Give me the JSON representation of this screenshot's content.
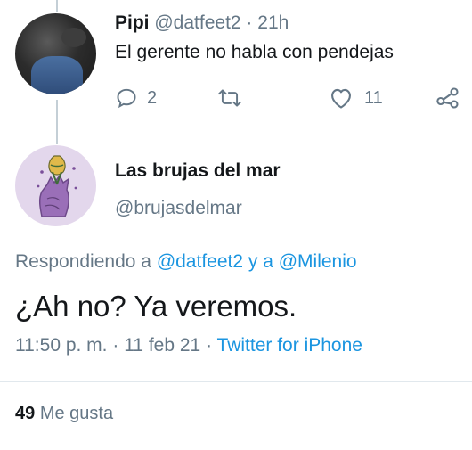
{
  "parent_tweet": {
    "name": "Pipi",
    "handle": "@datfeet2",
    "separator": "·",
    "time": "21h",
    "text": "El gerente no habla con pendejas",
    "reply_count": "2",
    "like_count": "11"
  },
  "main_tweet": {
    "name": "Las brujas del mar",
    "handle": "@brujasdelmar",
    "replying_prefix": "Respondiendo a",
    "reply_to_1": "@datfeet2",
    "reply_conjunction": "y a",
    "reply_to_2": "@Milenio",
    "text": "¿Ah no? Ya veremos.",
    "time": "11:50 p. m.",
    "sep1": "·",
    "date": "11 feb 21",
    "sep2": "·",
    "source": "Twitter for iPhone",
    "likes_count": "49",
    "likes_label": "Me gusta"
  },
  "icons": {
    "reply": "reply-icon",
    "retweet": "retweet-icon",
    "like": "heart-icon",
    "share": "share-icon"
  },
  "colors": {
    "link": "#1b95e0",
    "muted": "#657786",
    "text": "#14171a",
    "avatar_bg": "#e3d7ec"
  }
}
